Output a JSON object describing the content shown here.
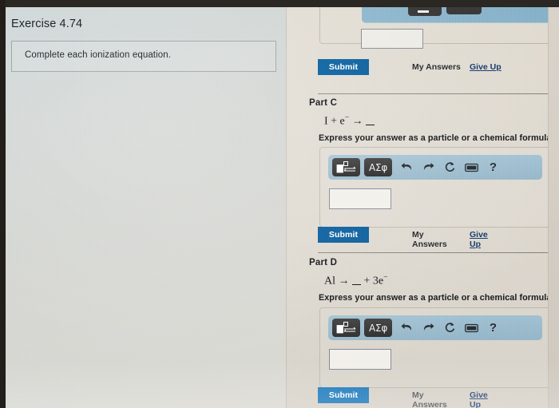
{
  "exercise": {
    "title": "Exercise 4.74",
    "prompt": "Complete each ionization equation."
  },
  "part_b_partial": {
    "submit_label": "Submit",
    "my_answers_label": "My Answers",
    "give_up_label": "Give Up"
  },
  "parts": [
    {
      "label": "Part C",
      "equation_lhs": "I + e",
      "equation_charge": "−",
      "equation_arrow": "→",
      "equation_full": "I + e⁻ → __",
      "instruction": "Express your answer as a particle or a chemical formula",
      "answer_value": "",
      "toolbar": {
        "template_label": "template-formula",
        "greek_label": "ΑΣφ",
        "undo_label": "undo",
        "redo_label": "redo",
        "reset_label": "reset",
        "keyboard_label": "keyboard",
        "help_label": "?"
      },
      "submit_label": "Submit",
      "my_answers_label": "My Answers",
      "give_up_label": "Give Up"
    },
    {
      "label": "Part D",
      "equation_lhs": "Al",
      "equation_arrow": "→",
      "equation_rhs": "+ 3e",
      "equation_charge": "−",
      "equation_full": "Al → __ + 3e⁻",
      "instruction": "Express your answer as a particle or a chemical formula",
      "answer_value": "",
      "toolbar": {
        "template_label": "template-formula",
        "greek_label": "ΑΣφ",
        "undo_label": "undo",
        "redo_label": "redo",
        "reset_label": "reset",
        "keyboard_label": "keyboard",
        "help_label": "?"
      },
      "submit_label": "Submit",
      "my_answers_label": "My Answers",
      "give_up_label": "Give Up"
    }
  ],
  "icons": {
    "undo": "↶",
    "redo": "↷",
    "reset": "↻",
    "keyboard": "⌨",
    "help": "?"
  },
  "colors": {
    "submit_blue": "#17639f",
    "toolbar_blue": "#a9c6d6",
    "link_blue": "#1b3f73",
    "left_pane": "#cfd7d8",
    "right_pane": "#e3ded4"
  }
}
